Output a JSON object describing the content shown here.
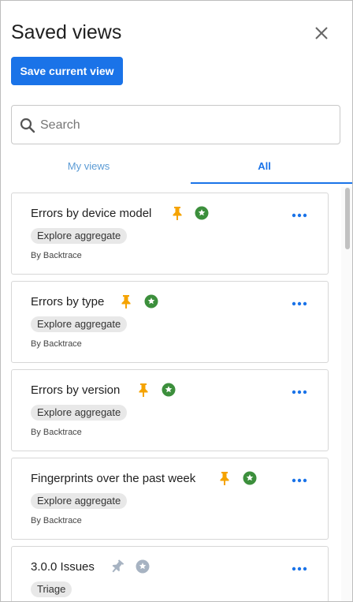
{
  "header": {
    "title": "Saved views"
  },
  "toolbar": {
    "save_label": "Save current view"
  },
  "search": {
    "placeholder": "Search",
    "value": ""
  },
  "tabs": [
    {
      "label": "My views",
      "active": false
    },
    {
      "label": "All",
      "active": true
    }
  ],
  "views": [
    {
      "name": "Errors by device model",
      "tag": "Explore aggregate",
      "owner": "By Backtrace",
      "pinned": true,
      "starred": true
    },
    {
      "name": "Errors by type",
      "tag": "Explore aggregate",
      "owner": "By Backtrace",
      "pinned": true,
      "starred": true
    },
    {
      "name": "Errors by version",
      "tag": "Explore aggregate",
      "owner": "By Backtrace",
      "pinned": true,
      "starred": true
    },
    {
      "name": "Fingerprints over the past week",
      "tag": "Explore aggregate",
      "owner": "By Backtrace",
      "pinned": true,
      "starred": true
    },
    {
      "name": "3.0.0 Issues",
      "tag": "Triage",
      "owner": "",
      "pinned": false,
      "starred": false
    }
  ],
  "colors": {
    "accent": "#1a73e8",
    "pin_active": "#f5a300",
    "star_active": "#3c8f3c",
    "icon_inactive": "#a7b3c2"
  },
  "icons": {
    "close": "close-icon",
    "search": "search-icon",
    "pin": "pin-icon",
    "star": "star-badge-icon",
    "more": "more-horizontal-icon"
  }
}
